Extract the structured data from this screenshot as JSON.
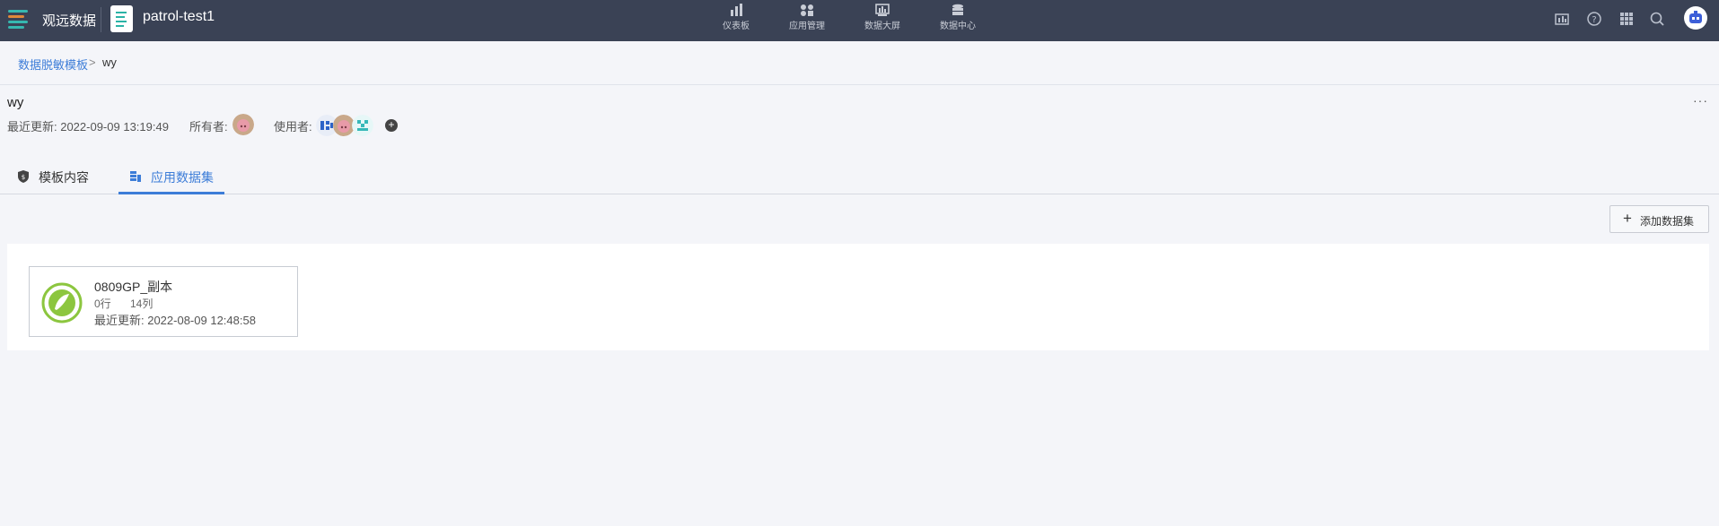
{
  "topbar": {
    "brand": "观远数据",
    "app_name": "patrol-test1",
    "nav": [
      {
        "label": "仪表板",
        "icon": "bar-chart-icon"
      },
      {
        "label": "应用管理",
        "icon": "apps-manage-icon"
      },
      {
        "label": "数据大屏",
        "icon": "big-screen-icon"
      },
      {
        "label": "数据中心",
        "icon": "data-center-icon"
      }
    ],
    "right_icons": [
      "screen-icon",
      "help-icon",
      "grid-icon",
      "search-icon",
      "user-avatar"
    ],
    "bg_color": "#3a4255",
    "accent": "#36b8b0"
  },
  "breadcrumb": {
    "parent": "数据脱敏模板",
    "separator": ">",
    "current": "wy"
  },
  "header": {
    "title": "wy",
    "updated_label": "最近更新: 2022-09-09 13:19:49",
    "owner_label": "所有者:",
    "users_label": "使用者:"
  },
  "tabs": [
    {
      "label": "模板内容",
      "icon": "shield-icon",
      "active": false
    },
    {
      "label": "应用数据集",
      "icon": "dataset-icon",
      "active": true
    }
  ],
  "actions": {
    "add_dataset": "添加数据集"
  },
  "datasets": [
    {
      "name": "0809GP_副本",
      "rows": "0行",
      "cols": "14列",
      "updated": "最近更新: 2022-08-09 12:48:58"
    }
  ],
  "colors": {
    "link": "#3d7dd8",
    "dataset_icon": "#8cc63f"
  }
}
